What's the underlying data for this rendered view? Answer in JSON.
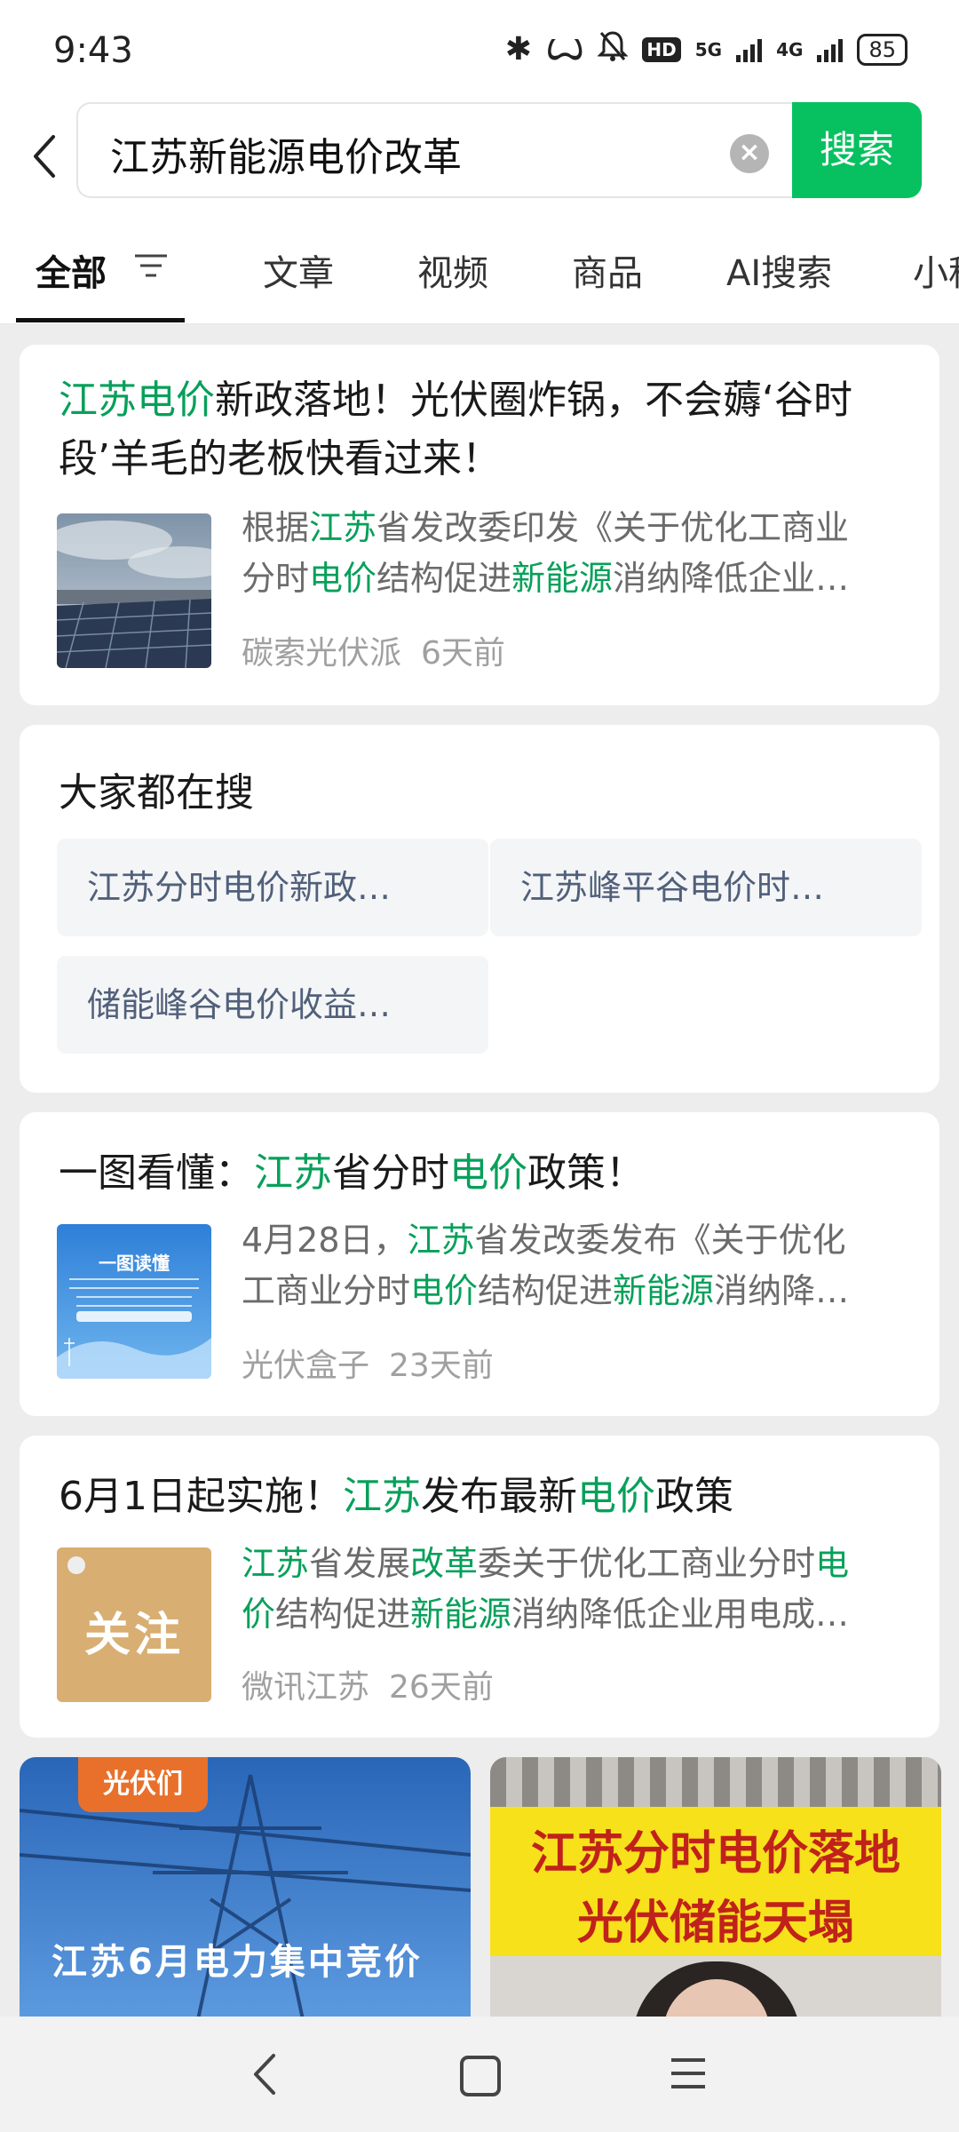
{
  "status": {
    "time": "9:43",
    "battery": "85",
    "hd": "HD",
    "net5g": "5G",
    "net4g": "4G"
  },
  "search": {
    "query": "江苏新能源电价改革",
    "button": "搜索"
  },
  "tabs": [
    "全部",
    "文章",
    "视频",
    "商品",
    "AI搜索",
    "小程"
  ],
  "results": [
    {
      "title_parts": [
        {
          "t": "江苏电价",
          "h": true
        },
        {
          "t": "新政落地！光伏圈炸锅，不会薅‘谷时段’羊毛的老板快看过来！",
          "h": false
        }
      ],
      "snippet_line1": [
        {
          "t": "根据",
          "h": false
        },
        {
          "t": "江苏",
          "h": true
        },
        {
          "t": "省发改委印发《关于优化工商业",
          "h": false
        }
      ],
      "snippet_line2": [
        {
          "t": "分时",
          "h": false
        },
        {
          "t": "电价",
          "h": true
        },
        {
          "t": "结构促进",
          "h": false
        },
        {
          "t": "新能源",
          "h": true
        },
        {
          "t": "消纳降低企业…",
          "h": false
        }
      ],
      "source": "碳索光伏派",
      "time": "6天前"
    },
    {
      "title_parts": [
        {
          "t": "一图看懂：",
          "h": false
        },
        {
          "t": "江苏",
          "h": true
        },
        {
          "t": "省分时",
          "h": false
        },
        {
          "t": "电价",
          "h": true
        },
        {
          "t": "政策！",
          "h": false
        }
      ],
      "snippet_line1": [
        {
          "t": "4月28日，",
          "h": false
        },
        {
          "t": "江苏",
          "h": true
        },
        {
          "t": "省发改委发布《关于优化",
          "h": false
        }
      ],
      "snippet_line2": [
        {
          "t": "工商业分时",
          "h": false
        },
        {
          "t": "电价",
          "h": true
        },
        {
          "t": "结构促进",
          "h": false
        },
        {
          "t": "新能源",
          "h": true
        },
        {
          "t": "消纳降…",
          "h": false
        }
      ],
      "source": "光伏盒子",
      "time": "23天前",
      "thumb_text": "一图读懂"
    },
    {
      "title_parts": [
        {
          "t": "6月1日起实施！",
          "h": false
        },
        {
          "t": "江苏",
          "h": true
        },
        {
          "t": "发布最新",
          "h": false
        },
        {
          "t": "电价",
          "h": true
        },
        {
          "t": "政策",
          "h": false
        }
      ],
      "snippet_line1": [
        {
          "t": "江苏",
          "h": true
        },
        {
          "t": "省发展",
          "h": false
        },
        {
          "t": "改革",
          "h": true
        },
        {
          "t": "委关于优化工商业分时",
          "h": false
        },
        {
          "t": "电",
          "h": true
        }
      ],
      "snippet_line2": [
        {
          "t": "价",
          "h": true
        },
        {
          "t": "结构促进",
          "h": false
        },
        {
          "t": "新能源",
          "h": true
        },
        {
          "t": "消纳降低企业用电成…",
          "h": false
        }
      ],
      "source": "微讯江苏",
      "time": "26天前",
      "thumb_text": "关注"
    }
  ],
  "people_search": {
    "title": "大家都在搜",
    "chips": [
      "江苏分时电价新政…",
      "江苏峰平谷电价时…",
      "储能峰谷电价收益…"
    ]
  },
  "videos": [
    {
      "logo": "光伏们",
      "caption": "江苏6月电力集中竞价"
    },
    {
      "line1": "江苏分时电价落地",
      "line2": "光伏储能天塌"
    }
  ]
}
